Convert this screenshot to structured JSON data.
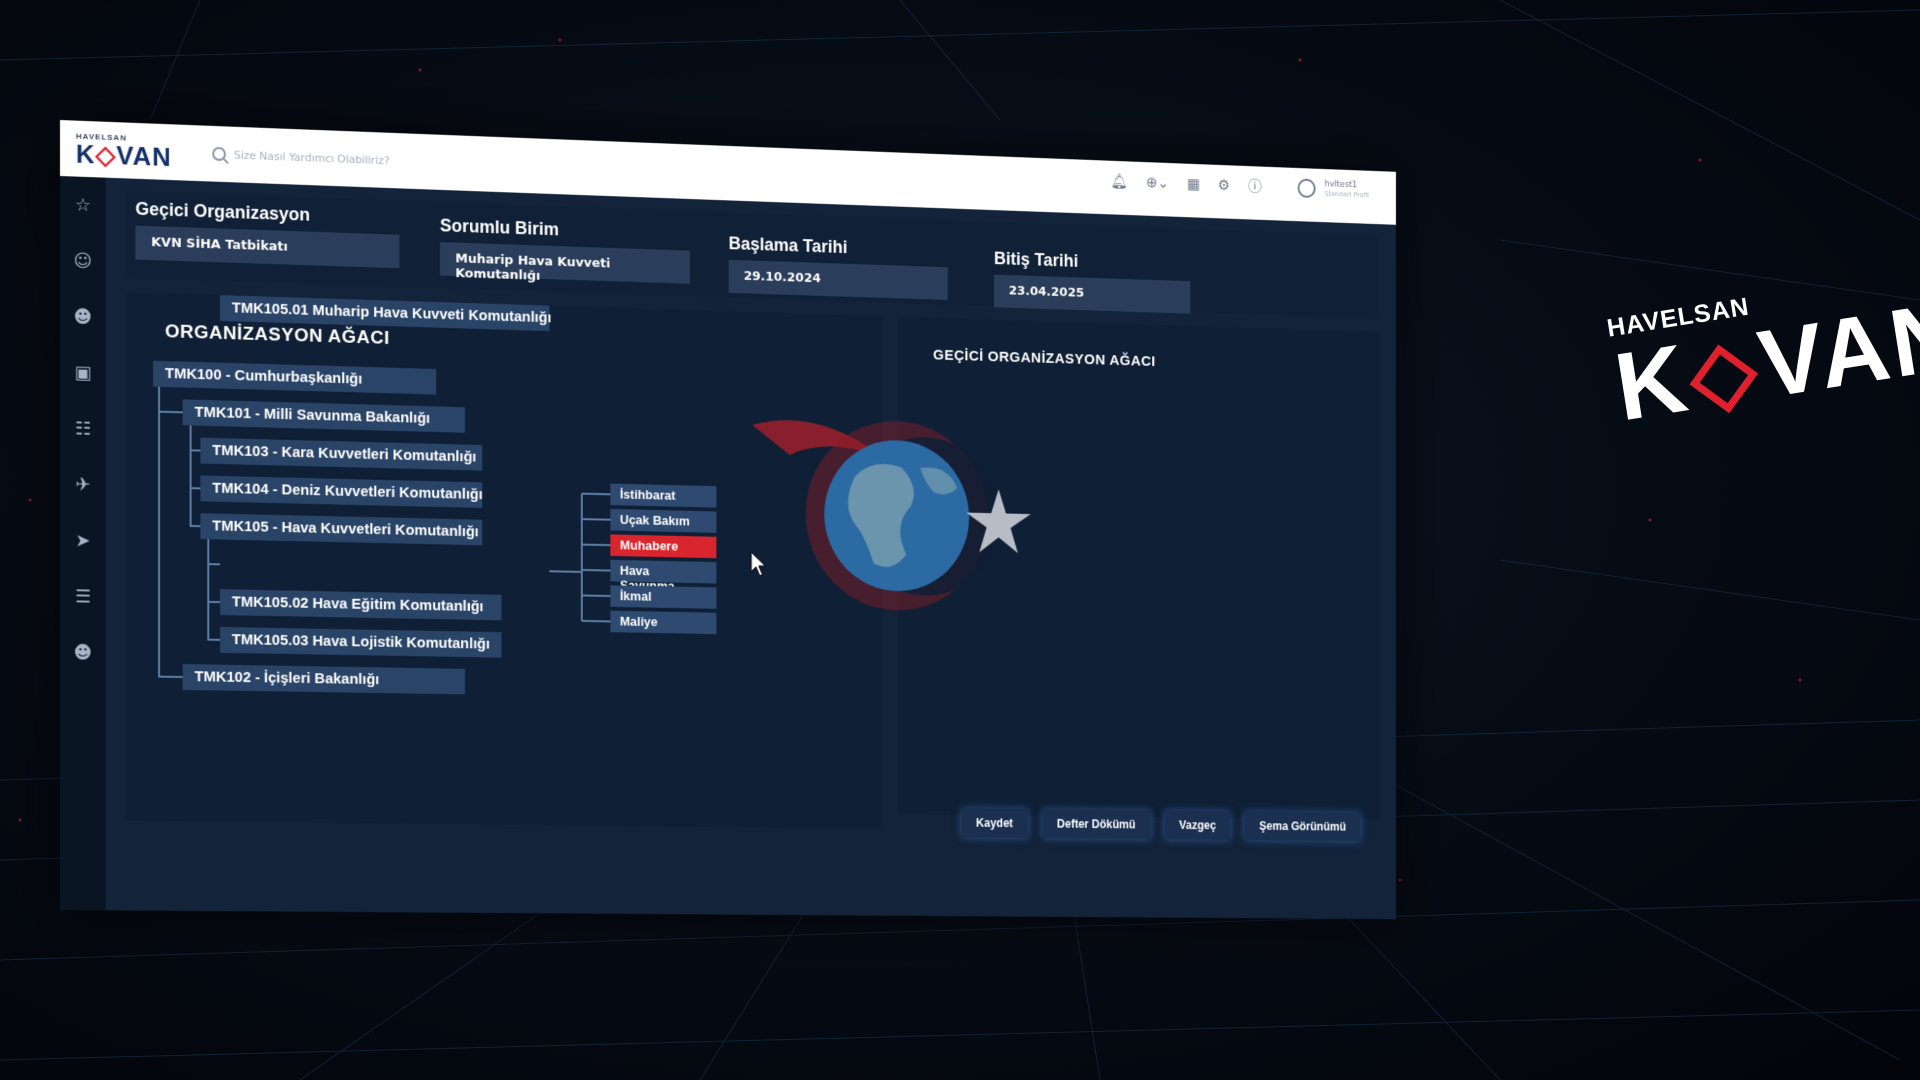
{
  "brand": {
    "company": "HAVELSAN",
    "product_pre": "K",
    "product_mark": "◇",
    "product_post": "VAN"
  },
  "topbar": {
    "search_placeholder": "Size Nasıl Yardımcı Olabiliriz?",
    "user_name": "hvltest1",
    "user_role": "Standart Profil"
  },
  "sidebar": {
    "icons": [
      "star-icon",
      "users-icon",
      "group-icon",
      "truck-icon",
      "grid-icon",
      "plane-icon",
      "drone-icon",
      "list-icon",
      "team-icon"
    ]
  },
  "form": {
    "org_label": "Geçici Organizasyon",
    "org_value": "KVN SİHA Tatbikatı",
    "unit_label": "Sorumlu Birim",
    "unit_value": "Muharip Hava Kuvveti Komutanlığı",
    "start_label": "Başlama Tarihi",
    "start_value": "29.10.2024",
    "end_label": "Bitiş Tarihi",
    "end_value": "23.04.2025"
  },
  "org_tree": {
    "title": "ORGANİZASYON AĞACI",
    "nodes": [
      {
        "label": "TMK100 - Cumhurbaşkanlığı"
      },
      {
        "label": "TMK101 - Milli Savunma Bakanlığı"
      },
      {
        "label": "TMK103 - Kara Kuvvetleri Komutanlığı"
      },
      {
        "label": "TMK104 - Deniz Kuvvetleri Komutanlığı"
      },
      {
        "label": "TMK105 - Hava Kuvvetleri Komutanlığı"
      },
      {
        "label": "TMK105.01 Muharip Hava Kuvveti Komutanlığı"
      },
      {
        "label": "TMK105.02 Hava Eğitim Komutanlığı"
      },
      {
        "label": "TMK105.03 Hava Lojistik Komutanlığı"
      },
      {
        "label": "TMK102 - İçişleri Bakanlığı"
      }
    ],
    "departments": [
      "İstihbarat",
      "Uçak Bakım",
      "Muhabere",
      "Hava Savunma",
      "İkmal",
      "Maliye"
    ],
    "active_department": "Muhabere"
  },
  "temp_tree": {
    "title": "GEÇİCİ ORGANİZASYON AĞACI"
  },
  "actions": {
    "save": "Kaydet",
    "ledger": "Defter Dökümü",
    "cancel": "Vazgeç",
    "schema": "Şema Görünümü"
  },
  "colors": {
    "accent_red": "#d9252e",
    "node_blue": "#2a4468",
    "panel_bg": "#0f1f35",
    "brand_navy": "#14306a"
  }
}
